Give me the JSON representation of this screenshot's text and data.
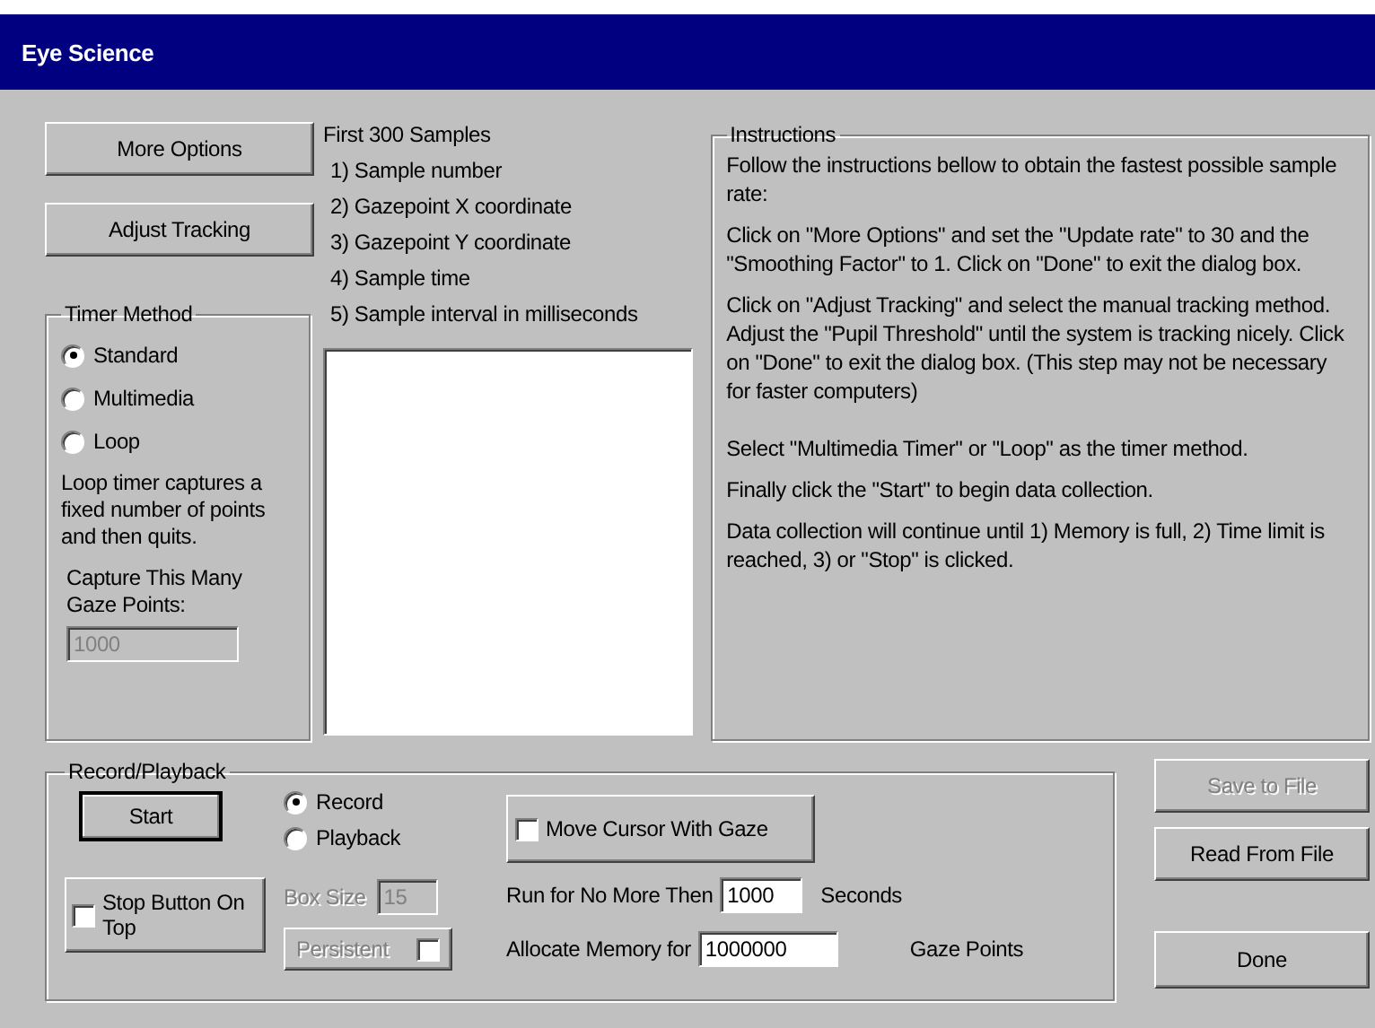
{
  "window": {
    "title": "Eye Science"
  },
  "left_buttons": [
    {
      "label": "More Options"
    },
    {
      "label": "Adjust Tracking"
    }
  ],
  "timer_method": {
    "title": "Timer Method",
    "options": [
      {
        "label": "Standard",
        "selected": true
      },
      {
        "label": "Multimedia",
        "selected": false
      },
      {
        "label": "Loop",
        "selected": false
      }
    ],
    "note": "Loop timer captures a fixed number of points and then quits.",
    "capture_label": "Capture This Many Gaze Points:",
    "capture_value": "1000",
    "capture_disabled": true
  },
  "samples": {
    "title": "First 300 Samples",
    "items": [
      "1) Sample number",
      "2) Gazepoint X coordinate",
      "3) Gazepoint Y coordinate",
      "4) Sample time",
      "5) Sample interval in milliseconds"
    ]
  },
  "instructions": {
    "title": "Instructions",
    "paragraphs": [
      "Follow the instructions bellow to obtain the fastest possible sample rate:",
      "Click on \"More Options\" and set the \"Update rate\" to 30 and the \"Smoothing Factor\" to 1. Click on \"Done\" to exit the dialog box.",
      "Click on \"Adjust Tracking\" and select the manual tracking method. Adjust the \"Pupil Threshold\" until the system is tracking nicely. Click on \"Done\" to exit the dialog box. (This step may not be necessary for faster computers)",
      "Select \"Multimedia Timer\" or \"Loop\" as the timer method.",
      "Finally click the \"Start\" to begin data collection.",
      "Data collection will continue until 1) Memory is full, 2) Time limit is reached, 3) or \"Stop\" is clicked."
    ]
  },
  "record_playback": {
    "title": "Record/Playback",
    "start_button": "Start",
    "modes": [
      {
        "label": "Record",
        "selected": true
      },
      {
        "label": "Playback",
        "selected": false
      }
    ],
    "move_cursor": {
      "label": "Move Cursor With Gaze",
      "checked": false
    },
    "stop_on_top": {
      "label": "Stop Button On Top",
      "checked": false
    },
    "box_size": {
      "label": "Box Size",
      "value": "15",
      "disabled": true
    },
    "persistent": {
      "label": "Persistent",
      "checked": false,
      "disabled": true
    },
    "run_limit": {
      "label": "Run for No More Then",
      "value": "1000",
      "unit": "Seconds"
    },
    "memory": {
      "label": "Allocate Memory for",
      "value": "1000000",
      "unit": "Gaze Points"
    }
  },
  "side_buttons": [
    {
      "label": "Save to File",
      "disabled": true
    },
    {
      "label": "Read From File",
      "disabled": false
    },
    {
      "label": "Done",
      "disabled": false
    }
  ]
}
